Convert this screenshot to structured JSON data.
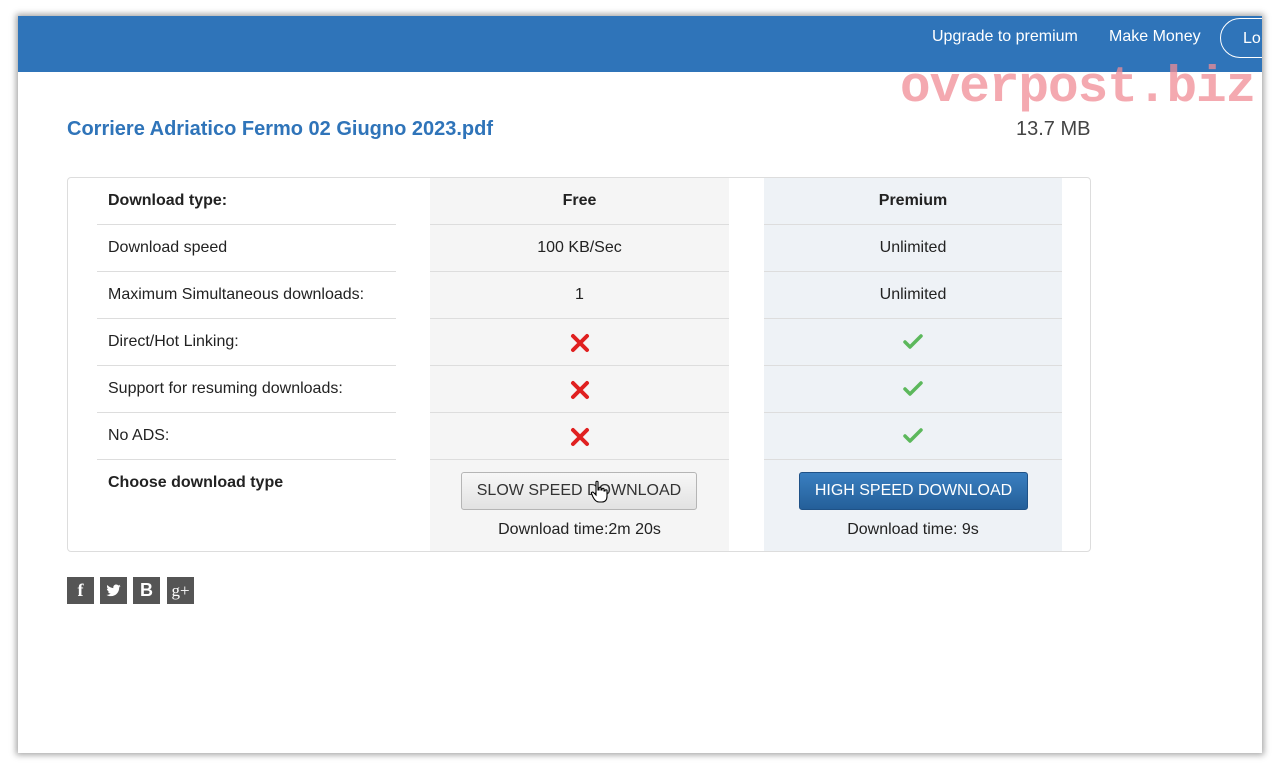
{
  "nav": {
    "upgrade": "Upgrade to premium",
    "make_money": "Make Money",
    "login": "Lo"
  },
  "watermark": "overpost.biz",
  "file": {
    "name": "Corriere Adriatico Fermo 02 Giugno 2023.pdf",
    "size": "13.7 MB"
  },
  "table": {
    "header": {
      "label": "Download type:",
      "free": "Free",
      "premium": "Premium"
    },
    "rows": [
      {
        "label": "Download speed",
        "free": "100 KB/Sec",
        "premium": "Unlimited"
      },
      {
        "label": "Maximum Simultaneous downloads:",
        "free": "1",
        "premium": "Unlimited"
      },
      {
        "label": "Direct/Hot Linking:",
        "free_icon": "cross-icon",
        "premium_icon": "check-icon"
      },
      {
        "label": "Support for resuming downloads:",
        "free_icon": "cross-icon",
        "premium_icon": "check-icon"
      },
      {
        "label": "No ADS:",
        "free_icon": "cross-icon",
        "premium_icon": "check-icon"
      }
    ],
    "choose_label": "Choose download type",
    "slow_button": "SLOW SPEED DOWNLOAD",
    "fast_button": "HIGH SPEED DOWNLOAD",
    "slow_time": "Download time:2m 20s",
    "fast_time": "Download time: 9s"
  },
  "social": {
    "facebook": "f",
    "blogger": "B",
    "google_plus": "g+"
  },
  "colors": {
    "header_bg": "#2f74b9",
    "title": "#2f74b9",
    "cross": "#e02020",
    "check": "#5cb85c",
    "primary_button": "#2a6aaa"
  }
}
